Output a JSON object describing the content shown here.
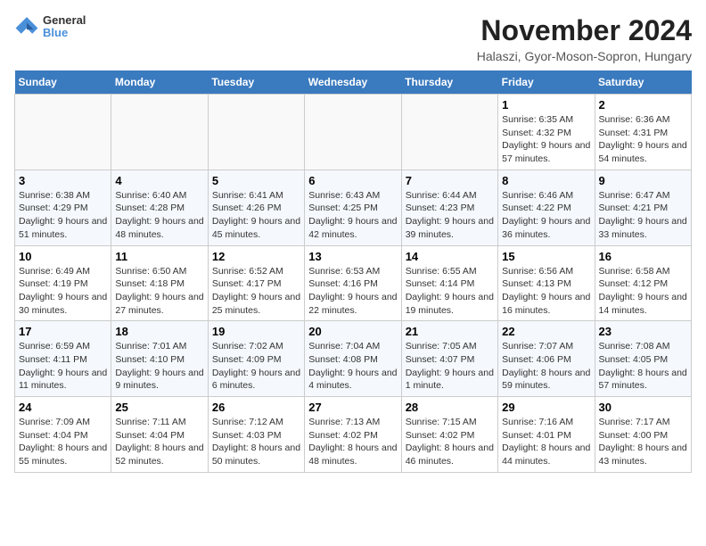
{
  "header": {
    "logo_line1": "General",
    "logo_line2": "Blue",
    "month": "November 2024",
    "location": "Halaszi, Gyor-Moson-Sopron, Hungary"
  },
  "weekdays": [
    "Sunday",
    "Monday",
    "Tuesday",
    "Wednesday",
    "Thursday",
    "Friday",
    "Saturday"
  ],
  "weeks": [
    [
      {
        "day": "",
        "info": ""
      },
      {
        "day": "",
        "info": ""
      },
      {
        "day": "",
        "info": ""
      },
      {
        "day": "",
        "info": ""
      },
      {
        "day": "",
        "info": ""
      },
      {
        "day": "1",
        "info": "Sunrise: 6:35 AM\nSunset: 4:32 PM\nDaylight: 9 hours and 57 minutes."
      },
      {
        "day": "2",
        "info": "Sunrise: 6:36 AM\nSunset: 4:31 PM\nDaylight: 9 hours and 54 minutes."
      }
    ],
    [
      {
        "day": "3",
        "info": "Sunrise: 6:38 AM\nSunset: 4:29 PM\nDaylight: 9 hours and 51 minutes."
      },
      {
        "day": "4",
        "info": "Sunrise: 6:40 AM\nSunset: 4:28 PM\nDaylight: 9 hours and 48 minutes."
      },
      {
        "day": "5",
        "info": "Sunrise: 6:41 AM\nSunset: 4:26 PM\nDaylight: 9 hours and 45 minutes."
      },
      {
        "day": "6",
        "info": "Sunrise: 6:43 AM\nSunset: 4:25 PM\nDaylight: 9 hours and 42 minutes."
      },
      {
        "day": "7",
        "info": "Sunrise: 6:44 AM\nSunset: 4:23 PM\nDaylight: 9 hours and 39 minutes."
      },
      {
        "day": "8",
        "info": "Sunrise: 6:46 AM\nSunset: 4:22 PM\nDaylight: 9 hours and 36 minutes."
      },
      {
        "day": "9",
        "info": "Sunrise: 6:47 AM\nSunset: 4:21 PM\nDaylight: 9 hours and 33 minutes."
      }
    ],
    [
      {
        "day": "10",
        "info": "Sunrise: 6:49 AM\nSunset: 4:19 PM\nDaylight: 9 hours and 30 minutes."
      },
      {
        "day": "11",
        "info": "Sunrise: 6:50 AM\nSunset: 4:18 PM\nDaylight: 9 hours and 27 minutes."
      },
      {
        "day": "12",
        "info": "Sunrise: 6:52 AM\nSunset: 4:17 PM\nDaylight: 9 hours and 25 minutes."
      },
      {
        "day": "13",
        "info": "Sunrise: 6:53 AM\nSunset: 4:16 PM\nDaylight: 9 hours and 22 minutes."
      },
      {
        "day": "14",
        "info": "Sunrise: 6:55 AM\nSunset: 4:14 PM\nDaylight: 9 hours and 19 minutes."
      },
      {
        "day": "15",
        "info": "Sunrise: 6:56 AM\nSunset: 4:13 PM\nDaylight: 9 hours and 16 minutes."
      },
      {
        "day": "16",
        "info": "Sunrise: 6:58 AM\nSunset: 4:12 PM\nDaylight: 9 hours and 14 minutes."
      }
    ],
    [
      {
        "day": "17",
        "info": "Sunrise: 6:59 AM\nSunset: 4:11 PM\nDaylight: 9 hours and 11 minutes."
      },
      {
        "day": "18",
        "info": "Sunrise: 7:01 AM\nSunset: 4:10 PM\nDaylight: 9 hours and 9 minutes."
      },
      {
        "day": "19",
        "info": "Sunrise: 7:02 AM\nSunset: 4:09 PM\nDaylight: 9 hours and 6 minutes."
      },
      {
        "day": "20",
        "info": "Sunrise: 7:04 AM\nSunset: 4:08 PM\nDaylight: 9 hours and 4 minutes."
      },
      {
        "day": "21",
        "info": "Sunrise: 7:05 AM\nSunset: 4:07 PM\nDaylight: 9 hours and 1 minute."
      },
      {
        "day": "22",
        "info": "Sunrise: 7:07 AM\nSunset: 4:06 PM\nDaylight: 8 hours and 59 minutes."
      },
      {
        "day": "23",
        "info": "Sunrise: 7:08 AM\nSunset: 4:05 PM\nDaylight: 8 hours and 57 minutes."
      }
    ],
    [
      {
        "day": "24",
        "info": "Sunrise: 7:09 AM\nSunset: 4:04 PM\nDaylight: 8 hours and 55 minutes."
      },
      {
        "day": "25",
        "info": "Sunrise: 7:11 AM\nSunset: 4:04 PM\nDaylight: 8 hours and 52 minutes."
      },
      {
        "day": "26",
        "info": "Sunrise: 7:12 AM\nSunset: 4:03 PM\nDaylight: 8 hours and 50 minutes."
      },
      {
        "day": "27",
        "info": "Sunrise: 7:13 AM\nSunset: 4:02 PM\nDaylight: 8 hours and 48 minutes."
      },
      {
        "day": "28",
        "info": "Sunrise: 7:15 AM\nSunset: 4:02 PM\nDaylight: 8 hours and 46 minutes."
      },
      {
        "day": "29",
        "info": "Sunrise: 7:16 AM\nSunset: 4:01 PM\nDaylight: 8 hours and 44 minutes."
      },
      {
        "day": "30",
        "info": "Sunrise: 7:17 AM\nSunset: 4:00 PM\nDaylight: 8 hours and 43 minutes."
      }
    ]
  ]
}
